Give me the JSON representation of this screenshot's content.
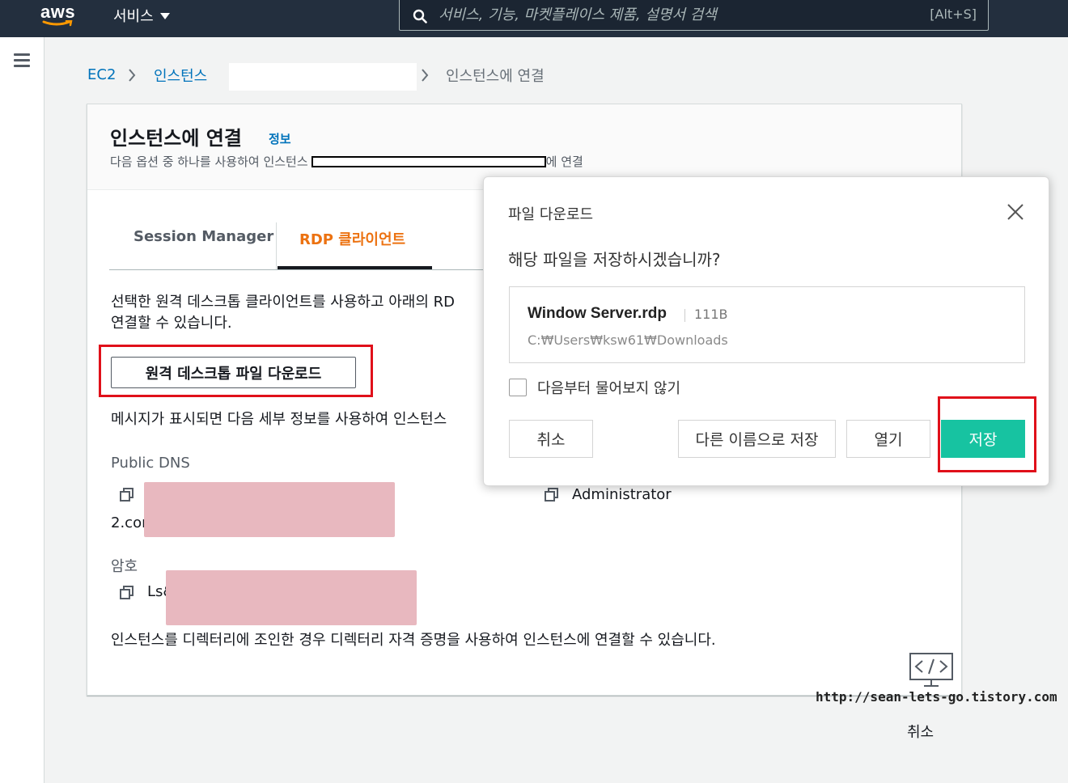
{
  "topbar": {
    "logo_text": "aws",
    "services_label": "서비스",
    "search_placeholder": "서비스, 기능, 마켓플레이스 제품, 설명서 검색",
    "search_shortcut": "[Alt+S]"
  },
  "breadcrumb": {
    "items": [
      "EC2",
      "인스턴스",
      "인스턴스에 연결"
    ]
  },
  "panel": {
    "title": "인스턴스에 연결",
    "info_link": "정보",
    "subtitle_prefix": "다음 옵션 중 하나를 사용하여 인스턴스",
    "subtitle_suffix": "에 연결",
    "tabs": [
      "Session Manager",
      "RDP 클라이언트"
    ],
    "active_tab": "RDP 클라이언트",
    "description_line1": "선택한 원격 데스크톱 클라이언트를 사용하고 아래의 RD",
    "description_line2": "연결할 수 있습니다.",
    "download_button": "원격 데스크톱 파일 다운로드",
    "prompt_text": "메시지가 표시되면 다음 세부 정보를 사용하여 인스턴스",
    "public_dns_label": "Public DNS",
    "public_dns_value": "2.cor",
    "username_value": "Administrator",
    "password_label": "암호",
    "password_value": "Ls&",
    "footer_text": "인스턴스를 디렉터리에 조인한 경우 디렉터리 자격 증명을 사용하여 인스턴스에 연결할 수 있습니다."
  },
  "dialog": {
    "title": "파일 다운로드",
    "question": "해당 파일을 저장하시겠습니까?",
    "file_name": "Window Server.rdp",
    "file_size": "111B",
    "file_path": "C:₩Users₩ksw61₩Downloads",
    "checkbox_label": "다음부터 물어보지 않기",
    "checkbox_checked": false,
    "buttons": {
      "cancel": "취소",
      "save_as": "다른 이름으로 저장",
      "open": "열기",
      "save": "저장"
    },
    "save_color": "#17c3a1"
  },
  "watermark": "http://sean-lets-go.tistory.com",
  "bottom_cancel": "취소",
  "colors": {
    "nav_bg": "#232f3e",
    "link": "#0073bb",
    "active_tab": "#ec7211",
    "highlight": "#e0101a"
  }
}
